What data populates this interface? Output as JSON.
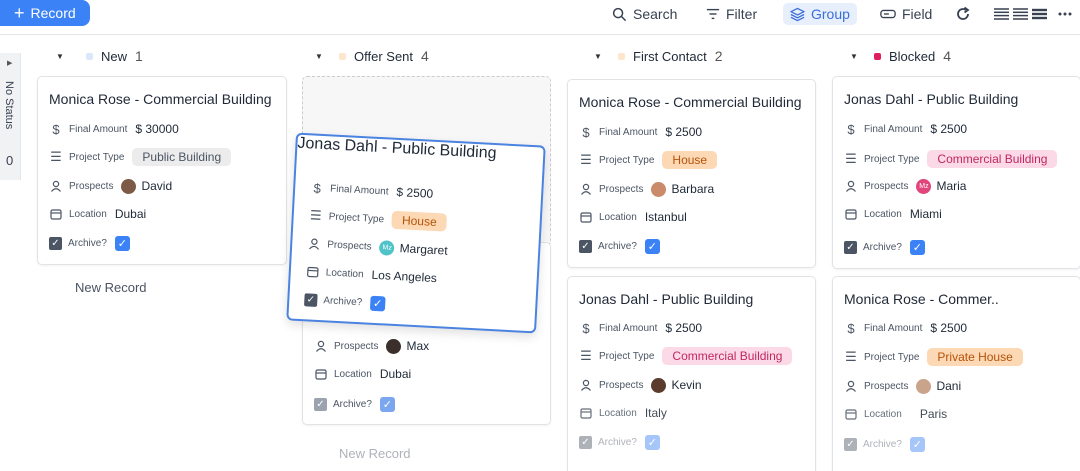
{
  "toolbar": {
    "record_label": "Record",
    "search_label": "Search",
    "filter_label": "Filter",
    "group_label": "Group",
    "field_label": "Field"
  },
  "no_status": {
    "label": "No Status",
    "count": "0"
  },
  "colors": {
    "accent": "#3b82f6",
    "new": "#dbe7fb",
    "offer_sent": "#fde7cc",
    "first_contact": "#fde7cc",
    "blocked": "#e11d62"
  },
  "field_labels": {
    "final_amount": "Final Amount",
    "project_type": "Project Type",
    "prospects": "Prospects",
    "location": "Location",
    "archive": "Archive?"
  },
  "columns": [
    {
      "name": "New",
      "count": "1",
      "new_record": "New Record"
    },
    {
      "name": "Offer Sent",
      "count": "4",
      "new_record": "New Record"
    },
    {
      "name": "First Contact",
      "count": "2"
    },
    {
      "name": "Blocked",
      "count": "4"
    }
  ],
  "cards": {
    "new_1": {
      "title": "Monica Rose - Commercial Building",
      "amount": "$ 30000",
      "project_type": "Public Building",
      "prospect": "David",
      "location": "Dubai"
    },
    "dragging": {
      "title": "Jonas Dahl - Public Building",
      "amount": "$ 2500",
      "project_type": "House",
      "prospect": "Margaret",
      "prospect_initials": "Mz",
      "location": "Los Angeles"
    },
    "offer_2": {
      "prospect": "Max",
      "location": "Dubai"
    },
    "first_1": {
      "title": "Monica Rose - Commercial Building",
      "amount": "$ 2500",
      "project_type": "House",
      "prospect": "Barbara",
      "location": "Istanbul"
    },
    "first_2": {
      "title": "Jonas Dahl - Public Building",
      "amount": "$ 2500",
      "project_type": "Commercial Building",
      "prospect": "Kevin",
      "location": "Italy"
    },
    "blocked_1": {
      "title": "Jonas Dahl - Public Building",
      "amount": "$ 2500",
      "project_type": "Commercial Building",
      "prospect": "Maria",
      "prospect_initials": "Mz",
      "location": "Miami"
    },
    "blocked_2": {
      "title": "Monica Rose - Commer..",
      "amount": "$ 2500",
      "project_type": "Private House",
      "prospect": "Dani",
      "location": "Paris"
    }
  }
}
